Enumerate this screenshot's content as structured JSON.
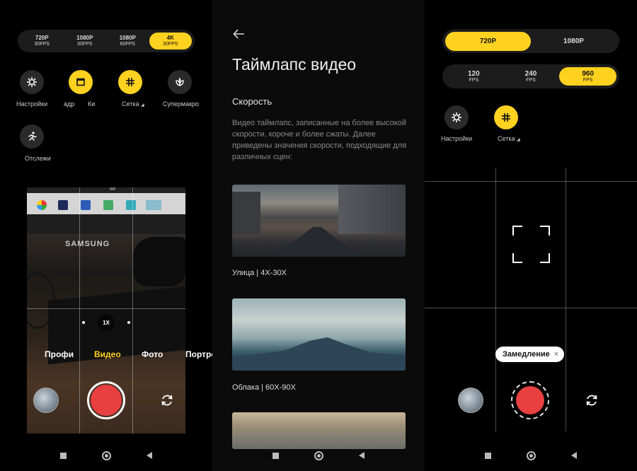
{
  "panel1": {
    "resolutions": [
      {
        "res": "720P",
        "fps": "30FPS",
        "active": false
      },
      {
        "res": "1080P",
        "fps": "30FPS",
        "active": false
      },
      {
        "res": "1080P",
        "fps": "60FPS",
        "active": false
      },
      {
        "res": "4K",
        "fps": "30FPS",
        "active": true
      }
    ],
    "settings_label": "Настройки",
    "frame_label": "адр",
    "cinema_label": "Ки",
    "grid_label": "Сетка",
    "supermacro_label": "Супермакро",
    "tracking_label": "Отслежи",
    "zoom_label": "1X",
    "modes": [
      "Профи",
      "Видео",
      "Фото",
      "Портре"
    ],
    "active_mode": "Видео",
    "monitor_brand": "SAMSUNG"
  },
  "panel2": {
    "title": "Таймлапс видео",
    "section": "Скорость",
    "description": "Видео таймлапс, записанные на более высокой скорости, короче и более сжаты. Далее приведены значения скорости, подходящие для различных сцен:",
    "examples": [
      {
        "caption": "Улица | 4X-30X"
      },
      {
        "caption": "Облака | 60X-90X"
      }
    ]
  },
  "panel3": {
    "resolutions": [
      {
        "label": "720P",
        "active": true
      },
      {
        "label": "1080P",
        "active": false
      }
    ],
    "fps": [
      {
        "value": "120",
        "unit": "FPS",
        "active": false
      },
      {
        "value": "240",
        "unit": "FPS",
        "active": false
      },
      {
        "value": "960",
        "unit": "FPS",
        "active": true
      }
    ],
    "settings_label": "Настройки",
    "grid_label": "Сетка",
    "chip_label": "Замедление",
    "chip_close": "×"
  },
  "colors": {
    "accent": "#ffd21f",
    "record": "#e84040",
    "background": "#000000"
  }
}
